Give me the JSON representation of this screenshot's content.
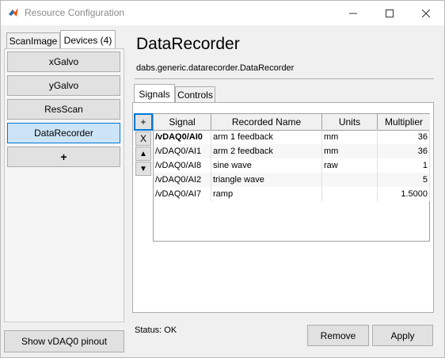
{
  "window": {
    "title": "Resource Configuration",
    "icons": [
      "matlab-app-icon",
      "minimize-icon",
      "maximize-icon",
      "close-icon"
    ]
  },
  "left_tabs": [
    {
      "label": "ScanImage",
      "active": false
    },
    {
      "label": "Devices (4)",
      "active": true
    }
  ],
  "devices": [
    {
      "label": "xGalvo",
      "selected": false
    },
    {
      "label": "yGalvo",
      "selected": false
    },
    {
      "label": "ResScan",
      "selected": false
    },
    {
      "label": "DataRecorder",
      "selected": true
    },
    {
      "label": "+",
      "selected": false
    }
  ],
  "show_pinout_label": "Show vDAQ0 pinout",
  "device": {
    "title": "DataRecorder",
    "class_name": "dabs.generic.datarecorder.DataRecorder"
  },
  "right_tabs": [
    {
      "label": "Signals",
      "active": true
    },
    {
      "label": "Controls",
      "active": false
    }
  ],
  "side_buttons": {
    "add": "+",
    "remove": "X",
    "up": "▲",
    "down": "▼"
  },
  "table": {
    "columns": [
      "Signal",
      "Recorded Name",
      "Units",
      "Multiplier"
    ],
    "rows": [
      {
        "signal": "/vDAQ0/AI0",
        "recorded_name": "arm 1 feedback",
        "units": "mm",
        "multiplier": "36"
      },
      {
        "signal": "/vDAQ0/AI1",
        "recorded_name": "arm 2 feedback",
        "units": "mm",
        "multiplier": "36"
      },
      {
        "signal": "/vDAQ0/AI8",
        "recorded_name": "sine wave",
        "units": "raw",
        "multiplier": "1"
      },
      {
        "signal": "/vDAQ0/AI2",
        "recorded_name": "triangle wave",
        "units": "",
        "multiplier": "5"
      },
      {
        "signal": "/vDAQ0/AI7",
        "recorded_name": "ramp",
        "units": "",
        "multiplier": "1.5000"
      }
    ]
  },
  "status": "Status: OK",
  "buttons": {
    "remove": "Remove",
    "apply": "Apply"
  },
  "colors": {
    "selection_blue": "#cce4f7",
    "focus_border": "#0078d7"
  }
}
